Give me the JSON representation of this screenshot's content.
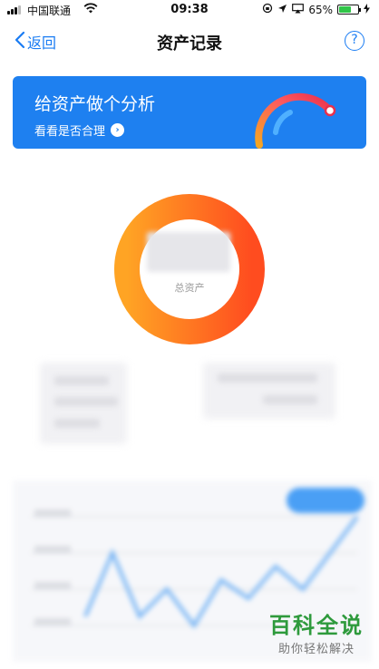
{
  "status_bar": {
    "carrier": "中国联通",
    "time": "09:38",
    "battery": "65%",
    "battery_level": 0.65
  },
  "nav": {
    "back_label": "返回",
    "title": "资产记录",
    "help_icon": "help-circle-icon"
  },
  "banner": {
    "title": "给资产做个分析",
    "subtitle": "看看是否合理",
    "arrow_icon": "chevron-right-circle-icon",
    "gauge_colors": [
      "#f5a623",
      "#ff5a5f",
      "#e8304c"
    ]
  },
  "summary": {
    "total_label": "总资产",
    "ring_colors": [
      "#ffa424",
      "#ff4c1f"
    ]
  },
  "watermark": {
    "title": "百科全说",
    "subtitle": "助你轻松解决"
  }
}
